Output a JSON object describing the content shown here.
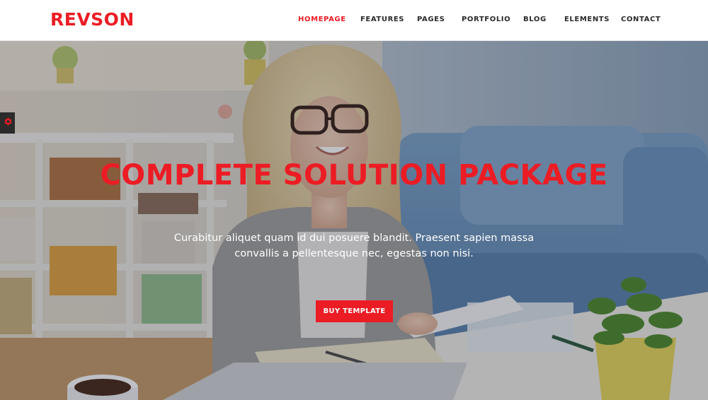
{
  "header": {
    "logo": "REVSON",
    "nav": [
      {
        "label": "HOMEPAGE",
        "active": true
      },
      {
        "label": "FEATURES",
        "active": false
      },
      {
        "label": "PAGES",
        "active": false
      },
      {
        "label": "PORTFOLIO",
        "active": false
      },
      {
        "label": "BLOG",
        "active": false
      },
      {
        "label": "ELEMENTS",
        "active": false
      },
      {
        "label": "CONTACT",
        "active": false
      }
    ]
  },
  "hero": {
    "title": "COMPLETE SOLUTION PACKAGE",
    "description_line1": "Curabitur aliquet quam id dui posuere blandit. Praesent sapien massa",
    "description_line2": "convallis a pellentesque nec, egestas non nisi.",
    "button_label": "BUY TEMPLATE"
  },
  "settings": {
    "icon": "gear-icon"
  },
  "colors": {
    "accent": "#ec1c24",
    "header_bg": "#ffffff",
    "nav_text": "#2a2a2a"
  }
}
